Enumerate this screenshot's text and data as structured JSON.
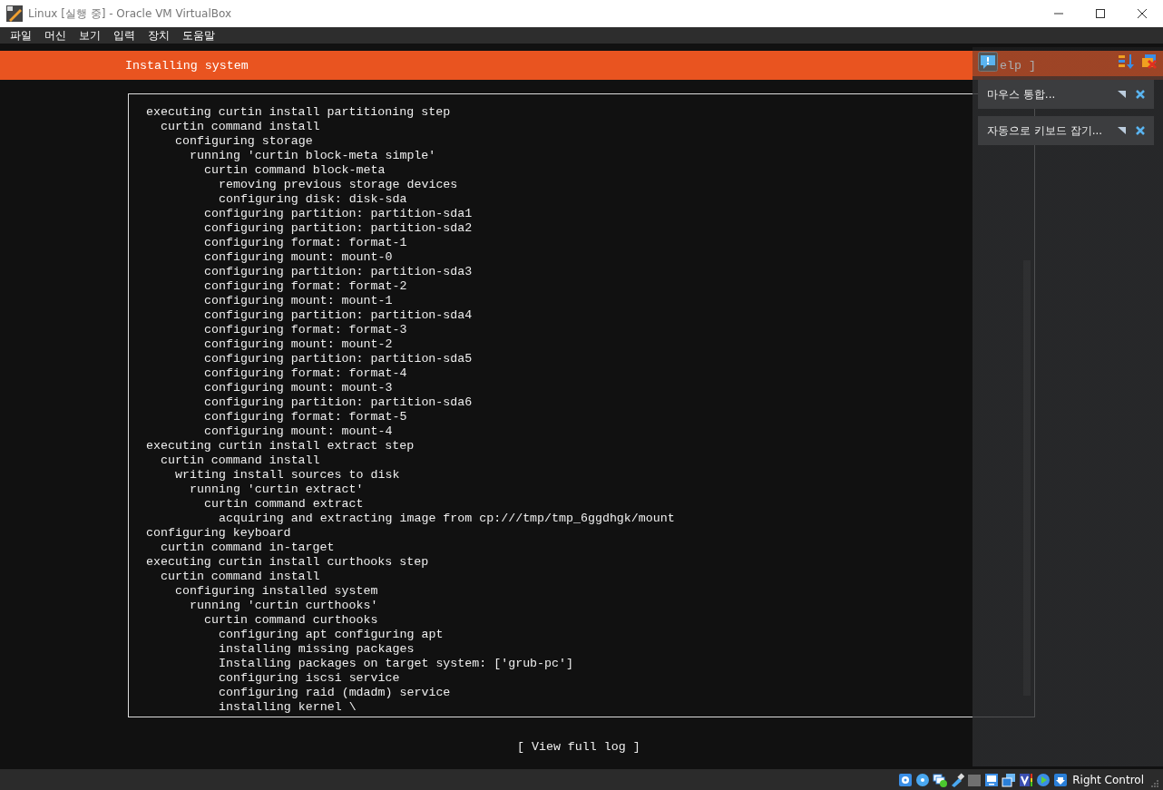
{
  "window": {
    "title": "Linux [실행 중] - Oracle VM VirtualBox"
  },
  "menu": [
    "파일",
    "머신",
    "보기",
    "입력",
    "장치",
    "도움말"
  ],
  "installer": {
    "header": "Installing system",
    "help_button": "elp ]",
    "view_log_button": "[ View full log ]",
    "log": [
      {
        "text": "executing curtin install partitioning step",
        "children": [
          {
            "text": "curtin command install",
            "children": [
              {
                "text": "configuring storage",
                "children": [
                  {
                    "text": "running 'curtin block-meta simple'",
                    "children": [
                      {
                        "text": "curtin command block-meta",
                        "children": [
                          {
                            "text": "removing previous storage devices"
                          },
                          {
                            "text": "configuring disk: disk-sda"
                          }
                        ]
                      },
                      {
                        "text": "configuring partition: partition-sda1"
                      },
                      {
                        "text": "configuring partition: partition-sda2"
                      },
                      {
                        "text": "configuring format: format-1"
                      },
                      {
                        "text": "configuring mount: mount-0"
                      },
                      {
                        "text": "configuring partition: partition-sda3"
                      },
                      {
                        "text": "configuring format: format-2"
                      },
                      {
                        "text": "configuring mount: mount-1"
                      },
                      {
                        "text": "configuring partition: partition-sda4"
                      },
                      {
                        "text": "configuring format: format-3"
                      },
                      {
                        "text": "configuring mount: mount-2"
                      },
                      {
                        "text": "configuring partition: partition-sda5"
                      },
                      {
                        "text": "configuring format: format-4"
                      },
                      {
                        "text": "configuring mount: mount-3"
                      },
                      {
                        "text": "configuring partition: partition-sda6"
                      },
                      {
                        "text": "configuring format: format-5"
                      },
                      {
                        "text": "configuring mount: mount-4"
                      }
                    ]
                  }
                ]
              }
            ]
          }
        ]
      },
      {
        "text": "executing curtin install extract step",
        "children": [
          {
            "text": "curtin command install",
            "children": [
              {
                "text": "writing install sources to disk",
                "children": [
                  {
                    "text": "running 'curtin extract'",
                    "children": [
                      {
                        "text": "curtin command extract",
                        "children": [
                          {
                            "text": "acquiring and extracting image from cp:///tmp/tmp_6ggdhgk/mount"
                          }
                        ]
                      }
                    ]
                  }
                ]
              }
            ]
          }
        ]
      },
      {
        "text": "configuring keyboard",
        "children": [
          {
            "text": "curtin command in-target"
          }
        ]
      },
      {
        "text": "executing curtin install curthooks step",
        "children": [
          {
            "text": "curtin command install",
            "children": [
              {
                "text": "configuring installed system",
                "children": [
                  {
                    "text": "running 'curtin curthooks'",
                    "children": [
                      {
                        "text": "curtin command curthooks",
                        "children": [
                          {
                            "text": "configuring apt configuring apt"
                          },
                          {
                            "text": "installing missing packages"
                          },
                          {
                            "text": "Installing packages on target system: ['grub-pc']"
                          },
                          {
                            "text": "configuring iscsi service"
                          },
                          {
                            "text": "configuring raid (mdadm) service"
                          },
                          {
                            "text": "installing kernel \\"
                          }
                        ]
                      }
                    ]
                  }
                ]
              }
            ]
          }
        ]
      }
    ]
  },
  "notifications": [
    {
      "text": "마우스 통합..."
    },
    {
      "text": "자동으로 키보드 잡기..."
    }
  ],
  "status_bar": {
    "host_key": "Right Control"
  }
}
